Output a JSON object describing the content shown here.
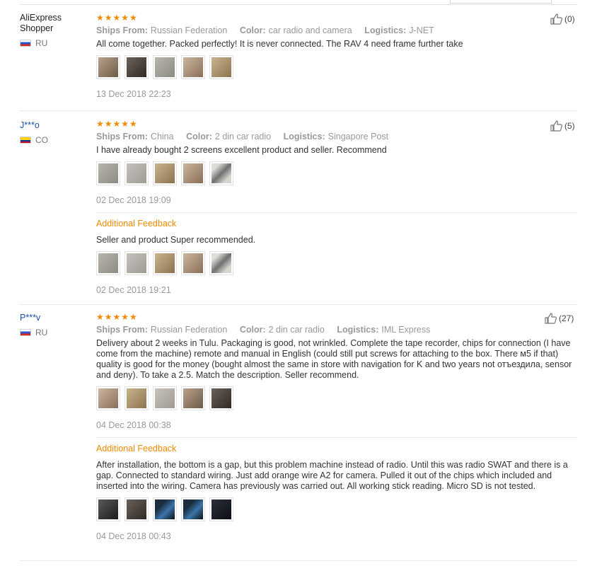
{
  "colors": {
    "accent": "#f08a00",
    "user_link": "#1c4f9e",
    "muted": "#999999"
  },
  "labels": {
    "ships_from": "Ships From:",
    "color": "Color:",
    "logistics": "Logistics:",
    "additional_feedback": "Additional Feedback",
    "stars": "★★★★★"
  },
  "reviews": [
    {
      "user": "AliExpress Shopper",
      "country": "RU",
      "helpful": "(0)",
      "ships_from": "Russian Federation",
      "color": "car radio and camera",
      "logistics": "J-NET",
      "text": "All come together. Packed perfectly! It is never connected. The RAV 4 need frame further take",
      "date": "13 Dec 2018 22:23"
    },
    {
      "user": "J***o",
      "country": "CO",
      "helpful": "(5)",
      "ships_from": "China",
      "color": "2 din car radio",
      "logistics": "Singapore Post",
      "text": "I have already bought 2 screens excellent product and seller. Recommend",
      "date": "02 Dec 2018 19:09",
      "additional": {
        "text": "Seller and product Super recommended.",
        "date": "02 Dec 2018 19:21"
      }
    },
    {
      "user": "P***v",
      "country": "RU",
      "helpful": "(27)",
      "ships_from": "Russian Federation",
      "color": "2 din car radio",
      "logistics": "IML Express",
      "text": "Delivery about 2 weeks in Tulu. Packaging is good, not wrinkled. Complete the tape recorder, chips for connection (I have come from the machine) remote and manual in English (could still put screws for attaching to the box. There м5 if that) quality is good for the money (bought almost the same in store with navigation for K and two years not отъездила, sensor and deny). To take a 2.5. Match the description. Seller recommend.",
      "date": "04 Dec 2018 00:38",
      "additional": {
        "text": "After installation, the bottom is a gap, but this problem machine instead of radio. Until this was radio SWAT and there is a gap. Connected to standard wiring. Just add orange wire A2 for camera. Pulled it out of the chips which included and inserted into the wiring. Camera has previously was carried out. All working stick reading. Micro SD is not tested.",
        "date": "04 Dec 2018 00:43"
      }
    }
  ]
}
